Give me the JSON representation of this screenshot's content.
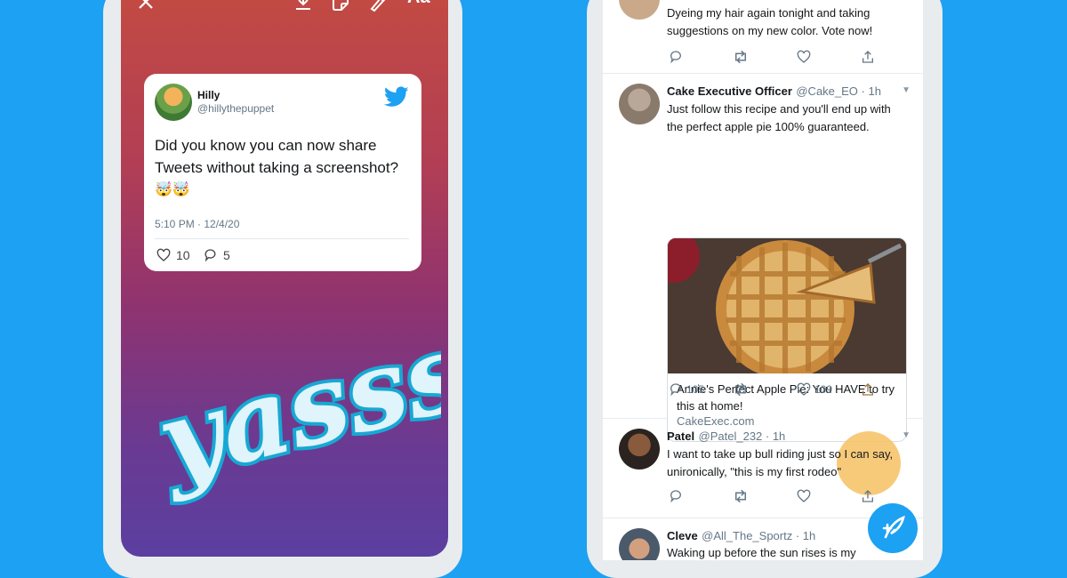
{
  "story": {
    "toolbar": {
      "close_icon": "close-icon",
      "download_icon": "download-icon",
      "sticker_icon": "sticker-icon",
      "draw_icon": "draw-icon",
      "text_label": "Aa"
    },
    "card": {
      "name": "Hilly",
      "handle": "@hillythepuppet",
      "text_line1": "Did you know you can now share",
      "text_line2": "Tweets without taking a screenshot?",
      "emoji": "🤯🤯",
      "timestamp": "5:10 PM · 12/4/20",
      "likes": "10",
      "replies": "5"
    },
    "sticker_text": "yasss"
  },
  "feed": {
    "tweet1": {
      "text_line1": "Dyeing my hair again tonight and taking",
      "text_line2": "suggestions on my new color. Vote now!"
    },
    "tweet2": {
      "name": "Cake Executive Officer",
      "handle": "@Cake_EO · 1h",
      "text": "Just follow this recipe and you'll end up with the perfect apple pie 100% guaranteed.",
      "card_title": "Annie's Perfect Apple Pie: You HAVE to try this at home!",
      "card_url": "CakeExec.com",
      "replies": "105",
      "likes": "109"
    },
    "tweet3": {
      "name": "Patel",
      "handle": "@Patel_232 · 1h",
      "text": "I want to take up bull riding just so I can say, unironically, \"this is my first rodeo\""
    },
    "tweet4": {
      "name": "Cleve",
      "handle": "@All_The_Sportz · 1h",
      "text": "Waking up before the sun rises is my"
    }
  },
  "colors": {
    "background": "#1da1f2",
    "highlight": "#f6c46b",
    "twitter_blue": "#1da1f2"
  }
}
